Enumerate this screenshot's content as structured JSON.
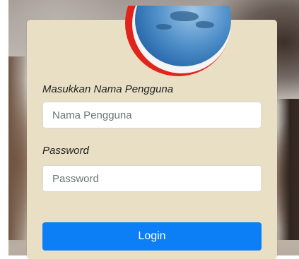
{
  "login_form": {
    "username_label": "Masukkan Nama Pengguna",
    "username_placeholder": "Nama Pengguna",
    "username_value": "",
    "password_label": "Password",
    "password_placeholder": "Password",
    "password_value": "",
    "login_label": "Login"
  },
  "logo": {
    "icon": "globe-emblem-icon"
  },
  "colors": {
    "card_background": "#e8dfc5",
    "button": "#0d7ff6",
    "button_text": "#ffffff",
    "logo_ring": "#e0241c"
  }
}
